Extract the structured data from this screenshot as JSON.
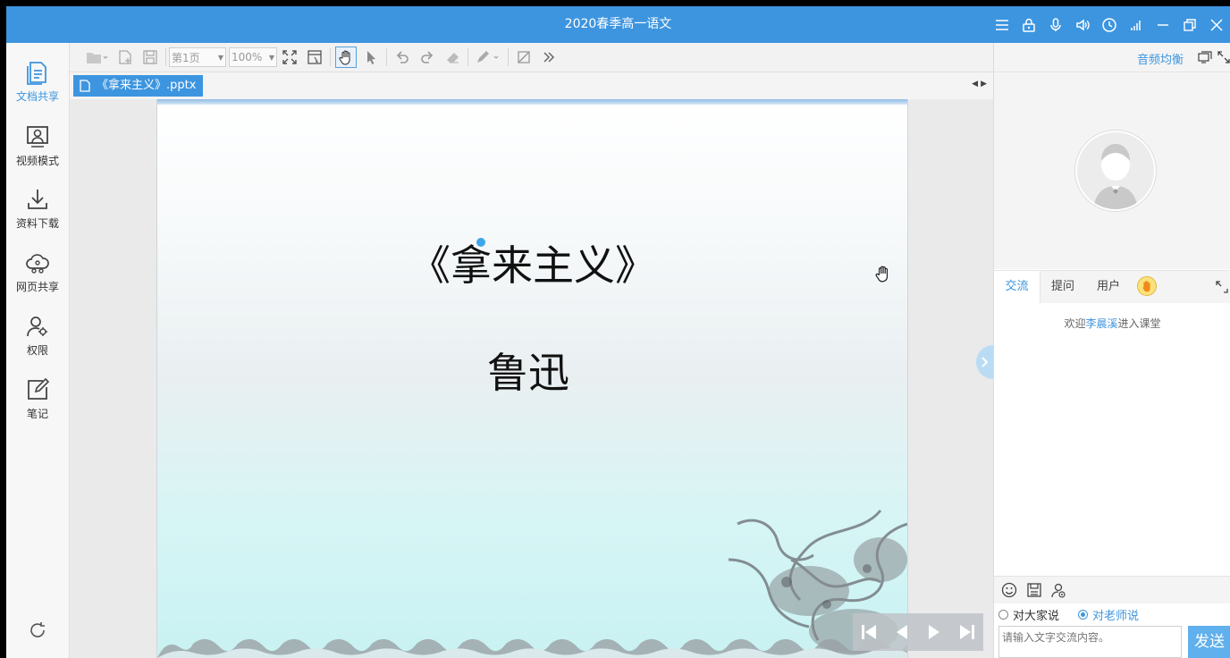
{
  "window": {
    "title": "2020春季高一语文"
  },
  "sidebar": {
    "items": [
      {
        "label": "文档共享",
        "icon": "document-icon"
      },
      {
        "label": "视频模式",
        "icon": "video-mode-icon"
      },
      {
        "label": "资料下载",
        "icon": "download-icon"
      },
      {
        "label": "网页共享",
        "icon": "cloud-share-icon"
      },
      {
        "label": "权限",
        "icon": "permission-icon"
      },
      {
        "label": "笔记",
        "icon": "note-icon"
      }
    ]
  },
  "toolbar": {
    "page_select": "第1页",
    "zoom_select": "100%"
  },
  "doc": {
    "tab_label": "《拿来主义》.pptx"
  },
  "slide": {
    "title": "《拿来主义》",
    "author": "鲁迅"
  },
  "rpanel": {
    "audio_balance": "音频均衡",
    "tabs": [
      "交流",
      "提问",
      "用户"
    ],
    "welcome_prefix": "欢迎",
    "welcome_name": "李晨溪",
    "welcome_suffix": "进入课堂",
    "radio_all": "对大家说",
    "radio_teacher": "对老师说",
    "input_placeholder": "请输入文字交流内容。",
    "send": "发送"
  },
  "alert": "!",
  "colors": {
    "accent": "#3d95df",
    "alert": "#e8291c",
    "send": "#5fb0ec"
  }
}
